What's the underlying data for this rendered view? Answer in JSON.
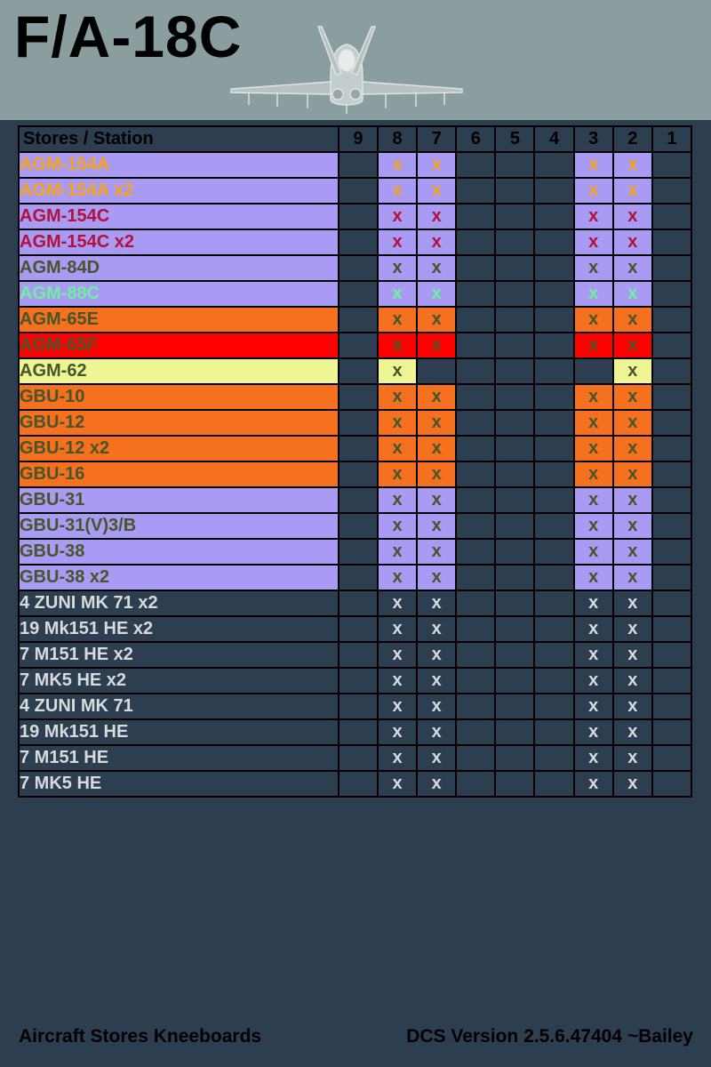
{
  "header": {
    "title": "F/A-18C"
  },
  "colors": {
    "background": "#2c3e50",
    "header_background": "#8a9ea0",
    "purple": "#a99bf4",
    "orange": "#f5711f",
    "red": "#ff0000",
    "yellow": "#eef595",
    "text_orange": "#f5a31a",
    "text_crimson": "#b3103c",
    "text_olive": "#46552a",
    "text_mint": "#6ef0a0",
    "text_light": "#d8dadc"
  },
  "table": {
    "headers": [
      "Stores / Station",
      "9",
      "8",
      "7",
      "6",
      "5",
      "4",
      "3",
      "2",
      "1"
    ],
    "mark": "x",
    "rows": [
      {
        "name": "AGM-154A",
        "bg": "#a99bf4",
        "text": "#f5a31a",
        "stations": [
          "",
          "x",
          "x",
          "",
          "",
          "",
          "x",
          "x",
          ""
        ]
      },
      {
        "name": "AGM-154A x2",
        "bg": "#a99bf4",
        "text": "#f5a31a",
        "stations": [
          "",
          "x",
          "x",
          "",
          "",
          "",
          "x",
          "x",
          ""
        ]
      },
      {
        "name": "AGM-154C",
        "bg": "#a99bf4",
        "text": "#b3103c",
        "stations": [
          "",
          "x",
          "x",
          "",
          "",
          "",
          "x",
          "x",
          ""
        ]
      },
      {
        "name": "AGM-154C x2",
        "bg": "#a99bf4",
        "text": "#b3103c",
        "stations": [
          "",
          "x",
          "x",
          "",
          "",
          "",
          "x",
          "x",
          ""
        ]
      },
      {
        "name": "AGM-84D",
        "bg": "#a99bf4",
        "text": "#46552a",
        "stations": [
          "",
          "x",
          "x",
          "",
          "",
          "",
          "x",
          "x",
          ""
        ]
      },
      {
        "name": "AGM-88C",
        "bg": "#a99bf4",
        "text": "#6ef0a0",
        "stations": [
          "",
          "x",
          "x",
          "",
          "",
          "",
          "x",
          "x",
          ""
        ]
      },
      {
        "name": "AGM-65E",
        "bg": "#f5711f",
        "text": "#46552a",
        "stations": [
          "",
          "x",
          "x",
          "",
          "",
          "",
          "x",
          "x",
          ""
        ]
      },
      {
        "name": "AGM-65F",
        "bg": "#ff0000",
        "text": "#46552a",
        "stations": [
          "",
          "x",
          "x",
          "",
          "",
          "",
          "x",
          "x",
          ""
        ]
      },
      {
        "name": "AGM-62",
        "bg": "#eef595",
        "text": "#46552a",
        "stations": [
          "",
          "x",
          "",
          "",
          "",
          "",
          "",
          "x",
          ""
        ]
      },
      {
        "name": "GBU-10",
        "bg": "#f5711f",
        "text": "#46552a",
        "stations": [
          "",
          "x",
          "x",
          "",
          "",
          "",
          "x",
          "x",
          ""
        ]
      },
      {
        "name": "GBU-12",
        "bg": "#f5711f",
        "text": "#46552a",
        "stations": [
          "",
          "x",
          "x",
          "",
          "",
          "",
          "x",
          "x",
          ""
        ]
      },
      {
        "name": "GBU-12 x2",
        "bg": "#f5711f",
        "text": "#46552a",
        "stations": [
          "",
          "x",
          "x",
          "",
          "",
          "",
          "x",
          "x",
          ""
        ]
      },
      {
        "name": "GBU-16",
        "bg": "#f5711f",
        "text": "#46552a",
        "stations": [
          "",
          "x",
          "x",
          "",
          "",
          "",
          "x",
          "x",
          ""
        ]
      },
      {
        "name": "GBU-31",
        "bg": "#a99bf4",
        "text": "#46552a",
        "stations": [
          "",
          "x",
          "x",
          "",
          "",
          "",
          "x",
          "x",
          ""
        ]
      },
      {
        "name": "GBU-31(V)3/B",
        "bg": "#a99bf4",
        "text": "#46552a",
        "stations": [
          "",
          "x",
          "x",
          "",
          "",
          "",
          "x",
          "x",
          ""
        ]
      },
      {
        "name": "GBU-38",
        "bg": "#a99bf4",
        "text": "#46552a",
        "stations": [
          "",
          "x",
          "x",
          "",
          "",
          "",
          "x",
          "x",
          ""
        ]
      },
      {
        "name": "GBU-38 x2",
        "bg": "#a99bf4",
        "text": "#46552a",
        "stations": [
          "",
          "x",
          "x",
          "",
          "",
          "",
          "x",
          "x",
          ""
        ]
      },
      {
        "name": "4 ZUNI MK 71 x2",
        "bg": "",
        "text": "#d8dadc",
        "stations": [
          "",
          "x",
          "x",
          "",
          "",
          "",
          "x",
          "x",
          ""
        ]
      },
      {
        "name": "19 Mk151 HE x2",
        "bg": "",
        "text": "#d8dadc",
        "stations": [
          "",
          "x",
          "x",
          "",
          "",
          "",
          "x",
          "x",
          ""
        ]
      },
      {
        "name": "7 M151 HE x2",
        "bg": "",
        "text": "#d8dadc",
        "stations": [
          "",
          "x",
          "x",
          "",
          "",
          "",
          "x",
          "x",
          ""
        ]
      },
      {
        "name": "7 MK5 HE x2",
        "bg": "",
        "text": "#d8dadc",
        "stations": [
          "",
          "x",
          "x",
          "",
          "",
          "",
          "x",
          "x",
          ""
        ]
      },
      {
        "name": "4 ZUNI MK 71",
        "bg": "",
        "text": "#d8dadc",
        "stations": [
          "",
          "x",
          "x",
          "",
          "",
          "",
          "x",
          "x",
          ""
        ]
      },
      {
        "name": "19 Mk151 HE",
        "bg": "",
        "text": "#d8dadc",
        "stations": [
          "",
          "x",
          "x",
          "",
          "",
          "",
          "x",
          "x",
          ""
        ]
      },
      {
        "name": "7 M151 HE",
        "bg": "",
        "text": "#d8dadc",
        "stations": [
          "",
          "x",
          "x",
          "",
          "",
          "",
          "x",
          "x",
          ""
        ]
      },
      {
        "name": "7 MK5 HE",
        "bg": "",
        "text": "#d8dadc",
        "stations": [
          "",
          "x",
          "x",
          "",
          "",
          "",
          "x",
          "x",
          ""
        ]
      }
    ]
  },
  "footer": {
    "left": "Aircraft Stores Kneeboards",
    "right": "DCS Version 2.5.6.47404 ~Bailey"
  }
}
